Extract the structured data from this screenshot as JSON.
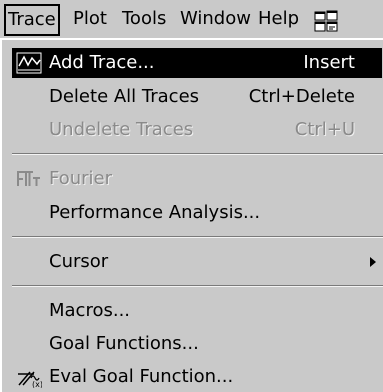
{
  "menubar": {
    "items": [
      {
        "label": "Trace"
      },
      {
        "label": "Plot"
      },
      {
        "label": "Tools"
      },
      {
        "label": "Window"
      },
      {
        "label": "Help"
      }
    ],
    "toolbar_icon": "window-grid-icon"
  },
  "menu": {
    "add_trace": {
      "label": "Add Trace...",
      "shortcut": "Insert",
      "icon": "add-trace-icon"
    },
    "delete_all_traces": {
      "label": "Delete All Traces",
      "shortcut": "Ctrl+Delete"
    },
    "undelete_traces": {
      "label": "Undelete Traces",
      "shortcut": "Ctrl+U"
    },
    "fourier": {
      "label": "Fourier",
      "icon": "fourier-icon"
    },
    "performance_analysis": {
      "label": "Performance Analysis..."
    },
    "cursor": {
      "label": "Cursor"
    },
    "macros": {
      "label": "Macros..."
    },
    "goal_functions": {
      "label": "Goal Functions..."
    },
    "eval_goal_function": {
      "label": "Eval Goal Function...",
      "icon": "eval-goal-function-icon"
    }
  },
  "colors": {
    "menu_bg": "#c9c9c9",
    "highlight_bg": "#000000",
    "disabled_text": "#8a8a8a"
  }
}
